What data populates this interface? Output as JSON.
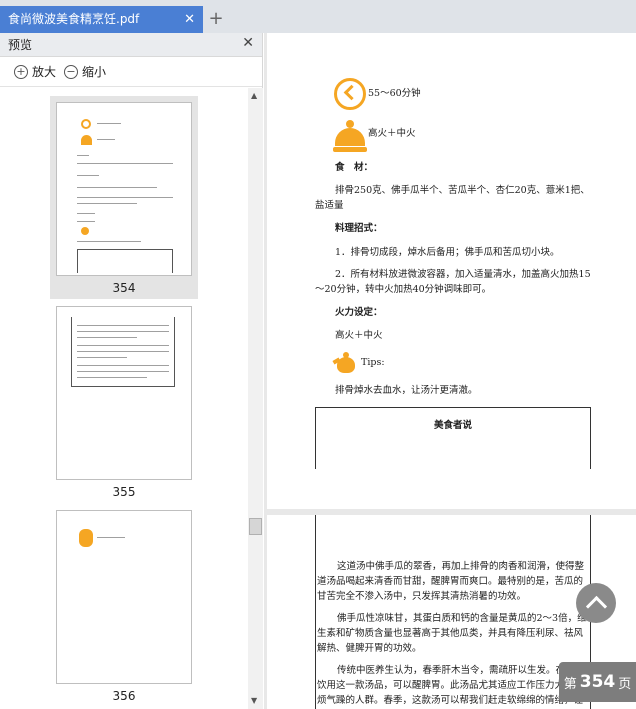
{
  "tab": {
    "title": "食尚微波美食精烹饪.pdf",
    "close": "✕",
    "add": "+"
  },
  "sidebar": {
    "title": "预览",
    "close": "✕",
    "zoom_in": "放大",
    "zoom_out": "缩小",
    "pages": [
      {
        "label": "354"
      },
      {
        "label": "355"
      },
      {
        "label": "356"
      }
    ]
  },
  "page1": {
    "time": "55～60分钟",
    "heat": "高火＋中火",
    "ingredients_label": "食　材：",
    "ingredients": "排骨250克、佛手瓜半个、苦瓜半个、杏仁20克、薏米1把、盐适量",
    "method_label": "料理招式：",
    "step1": "1．排骨切成段，焯水后备用；佛手瓜和苦瓜切小块。",
    "step2": "2．所有材料放进微波容器，加入适量清水，加盖高火加热15～20分钟，转中火加热40分钟调味即可。",
    "fire_label": "火力设定：",
    "fire": "高火＋中火",
    "tips_label": "Tips:",
    "tips": "排骨焯水去血水，让汤汁更清澈。",
    "box_title": "美食者说"
  },
  "page2": {
    "para1": "这道汤中佛手瓜的翠香，再加上排骨的肉香和润滑，使得整道汤品喝起来清香而甘甜，醒脾胃而爽口。最特别的是，苦瓜的甘苦完全不渗入汤中，只发挥其清热消暑的功效。",
    "para2": "佛手瓜性凉味甘，其蛋白质和钙的含量是黄瓜的2～3倍，维生素和矿物质含量也显著高于其他瓜类，并具有降压利尿、祛风解热、健脾开胃的功效。",
    "para3": "传统中医养生认为，春季肝木当令，需疏肝以生发。在春季饮用这一款汤品，可以醒脾胃。此汤品尤其适应工作压力大，心烦气躁的人群。春季，这款汤可以帮我们赶走软绵绵的情绪，让我们更醒神。"
  },
  "page_indicator": {
    "prefix": "第",
    "number": "354",
    "suffix": "页"
  }
}
